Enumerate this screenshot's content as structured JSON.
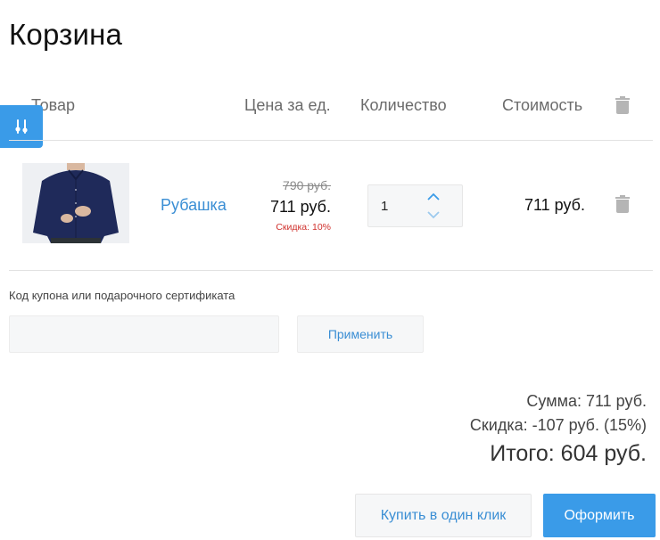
{
  "page": {
    "title": "Корзина"
  },
  "table": {
    "headers": {
      "product": "Товар",
      "price": "Цена за ед.",
      "quantity": "Количество",
      "cost": "Стоимость"
    },
    "items": [
      {
        "name": "Рубашка",
        "price_old": "790 руб.",
        "price_new": "711 руб.",
        "discount": "Скидка: 10%",
        "quantity": "1",
        "cost": "711 руб."
      }
    ]
  },
  "coupon": {
    "label": "Код купона или подарочного сертификата",
    "value": "",
    "apply_label": "Применить"
  },
  "summary": {
    "sum": "Сумма: 711 руб.",
    "discount": "Скидка: -107 руб. (15%)",
    "total": "Итого: 604 руб."
  },
  "actions": {
    "buy_one_click": "Купить в один клик",
    "checkout": "Оформить"
  },
  "colors": {
    "accent": "#3a9be8",
    "link": "#3a8ed4",
    "discount_red": "#d0312d",
    "icon_gray": "#b5b5b5"
  },
  "icons": {
    "filter": "sliders-icon",
    "delete": "trash-icon",
    "increase": "chevron-up-icon",
    "decrease": "chevron-down-icon"
  }
}
